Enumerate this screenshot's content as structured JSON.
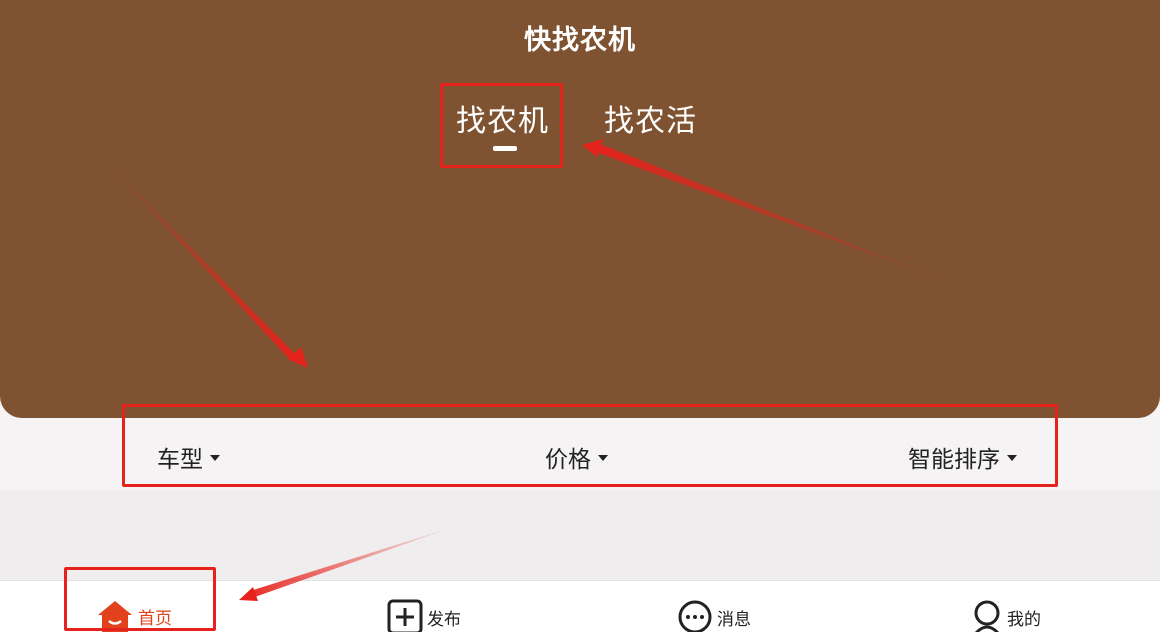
{
  "header": {
    "title": "快找农机",
    "tabs": [
      {
        "label": "找农机",
        "active": true
      },
      {
        "label": "找农活",
        "active": false
      }
    ]
  },
  "filters": [
    {
      "label": "车型",
      "icon": "caret-down-icon"
    },
    {
      "label": "价格",
      "icon": "caret-down-icon"
    },
    {
      "label": "智能排序",
      "icon": "caret-down-icon"
    }
  ],
  "bottom_nav": [
    {
      "label": "首页",
      "icon": "home-icon",
      "active": true
    },
    {
      "label": "发布",
      "icon": "plus-square-icon",
      "active": false
    },
    {
      "label": "消息",
      "icon": "chat-bubble-icon",
      "active": false
    },
    {
      "label": "我的",
      "icon": "user-icon",
      "active": false
    }
  ],
  "colors": {
    "header_bg": "#7f5331",
    "accent": "#e2421b",
    "annotation": "#e6221c",
    "page_bg": "#f5f3f3"
  }
}
